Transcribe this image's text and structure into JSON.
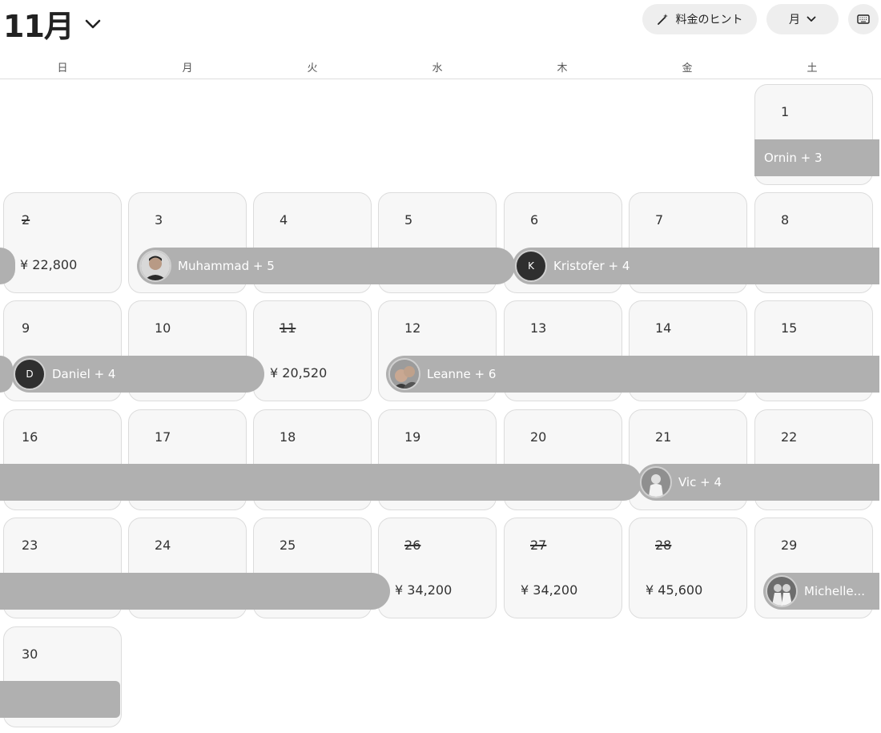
{
  "header": {
    "month": "11月",
    "pricing_tips_label": "料金のヒント",
    "view_label": "月"
  },
  "weekdays": [
    "日",
    "月",
    "火",
    "水",
    "木",
    "金",
    "土"
  ],
  "days": [
    {
      "day": "1",
      "struck": false,
      "price": ""
    },
    {
      "day": "2",
      "struck": true,
      "price": "¥ 22,800"
    },
    {
      "day": "3",
      "struck": false,
      "price": ""
    },
    {
      "day": "4",
      "struck": false,
      "price": ""
    },
    {
      "day": "5",
      "struck": false,
      "price": ""
    },
    {
      "day": "6",
      "struck": false,
      "price": ""
    },
    {
      "day": "7",
      "struck": false,
      "price": ""
    },
    {
      "day": "8",
      "struck": false,
      "price": ""
    },
    {
      "day": "9",
      "struck": false,
      "price": ""
    },
    {
      "day": "10",
      "struck": false,
      "price": ""
    },
    {
      "day": "11",
      "struck": true,
      "price": "¥ 20,520"
    },
    {
      "day": "12",
      "struck": false,
      "price": ""
    },
    {
      "day": "13",
      "struck": false,
      "price": ""
    },
    {
      "day": "14",
      "struck": false,
      "price": ""
    },
    {
      "day": "15",
      "struck": false,
      "price": ""
    },
    {
      "day": "16",
      "struck": false,
      "price": ""
    },
    {
      "day": "17",
      "struck": false,
      "price": ""
    },
    {
      "day": "18",
      "struck": false,
      "price": ""
    },
    {
      "day": "19",
      "struck": false,
      "price": ""
    },
    {
      "day": "20",
      "struck": false,
      "price": ""
    },
    {
      "day": "21",
      "struck": false,
      "price": ""
    },
    {
      "day": "22",
      "struck": false,
      "price": ""
    },
    {
      "day": "23",
      "struck": false,
      "price": ""
    },
    {
      "day": "24",
      "struck": false,
      "price": ""
    },
    {
      "day": "25",
      "struck": false,
      "price": ""
    },
    {
      "day": "26",
      "struck": true,
      "price": "¥ 34,200"
    },
    {
      "day": "27",
      "struck": true,
      "price": "¥ 34,200"
    },
    {
      "day": "28",
      "struck": true,
      "price": "¥ 45,600"
    },
    {
      "day": "29",
      "struck": false,
      "price": ""
    },
    {
      "day": "30",
      "struck": false,
      "price": ""
    }
  ],
  "reservations": [
    {
      "guest": "Ornin + 3",
      "avatar": "none",
      "initial": ""
    },
    {
      "guest": "",
      "avatar": "none",
      "initial": ""
    },
    {
      "guest": "Muhammad + 5",
      "avatar": "photo",
      "initial": ""
    },
    {
      "guest": "Kristofer + 4",
      "avatar": "letter",
      "initial": "K"
    },
    {
      "guest": "",
      "avatar": "none",
      "initial": ""
    },
    {
      "guest": "Daniel + 4",
      "avatar": "letter",
      "initial": "D"
    },
    {
      "guest": "Leanne + 6",
      "avatar": "photo",
      "initial": ""
    },
    {
      "guest": "",
      "avatar": "none",
      "initial": ""
    },
    {
      "guest": "Vic + 4",
      "avatar": "photo",
      "initial": ""
    },
    {
      "guest": "",
      "avatar": "none",
      "initial": ""
    },
    {
      "guest": "Michelle...",
      "avatar": "photo",
      "initial": ""
    },
    {
      "guest": "",
      "avatar": "none",
      "initial": ""
    }
  ]
}
